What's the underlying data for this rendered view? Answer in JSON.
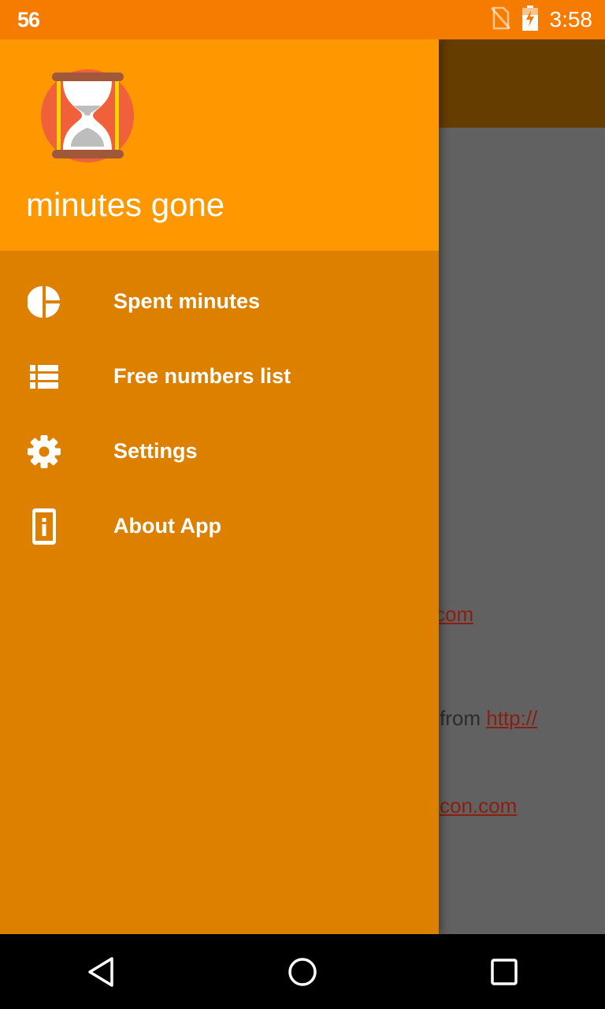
{
  "status_bar": {
    "left_text": "56",
    "time": "3:58",
    "icons": [
      "no-sim-icon",
      "battery-charging-icon"
    ]
  },
  "drawer": {
    "app_name": "minutes gone",
    "logo": "hourglass-logo",
    "menu_items": [
      {
        "label": "Spent minutes",
        "icon": "pie-chart-icon"
      },
      {
        "label": "Free numbers list",
        "icon": "list-icon"
      },
      {
        "label": "Settings",
        "icon": "gear-icon"
      },
      {
        "label": "About App",
        "icon": "info-icon"
      }
    ]
  },
  "background_content": {
    "line1_link": "com",
    "line2_text": "from ",
    "line2_link": "http://",
    "line3_link": "con.com"
  },
  "navigation": {
    "buttons": [
      "back-icon",
      "home-icon",
      "recents-icon"
    ]
  },
  "colors": {
    "status_bar": "#F57C00",
    "drawer_header": "#FF9800",
    "drawer_body": "#DD8000",
    "scrim": "#616161",
    "toolbar_dim": "#663D00"
  }
}
